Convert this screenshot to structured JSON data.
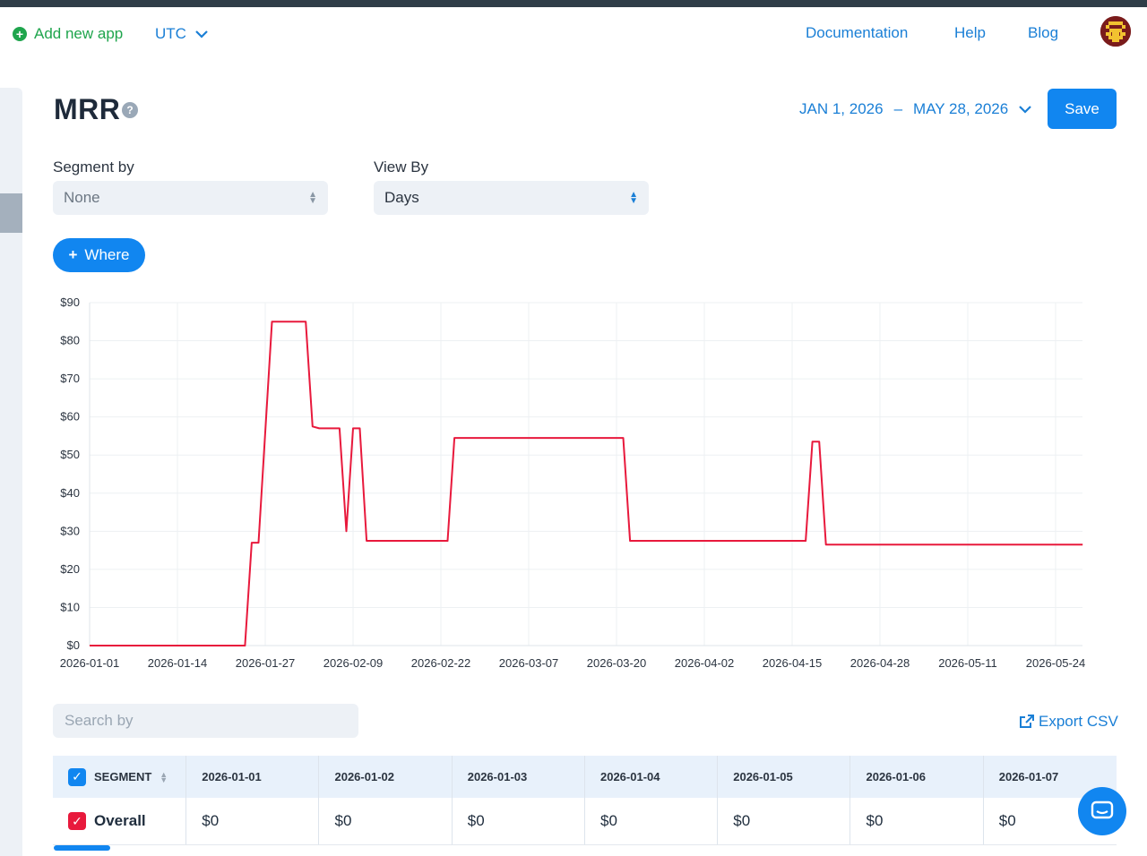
{
  "header": {
    "add_app_label": "Add new app",
    "timezone": "UTC",
    "nav": [
      {
        "label": "Documentation"
      },
      {
        "label": "Help"
      },
      {
        "label": "Blog"
      }
    ]
  },
  "page": {
    "title": "MRR",
    "help_symbol": "?",
    "date_start": "JAN 1, 2026",
    "date_separator": "–",
    "date_end": "MAY 28, 2026",
    "save_label": "Save",
    "segment_label": "Segment by",
    "segment_value": "None",
    "view_label": "View By",
    "view_value": "Days",
    "where_label": "Where",
    "search_placeholder": "Search by",
    "export_label": "Export CSV"
  },
  "chart_data": {
    "type": "line",
    "ylim": [
      0,
      90
    ],
    "yticks": [
      "$0",
      "$10",
      "$20",
      "$30",
      "$40",
      "$50",
      "$60",
      "$70",
      "$80",
      "$90"
    ],
    "xticks": [
      "2026-01-01",
      "2026-01-14",
      "2026-01-27",
      "2026-02-09",
      "2026-02-22",
      "2026-03-07",
      "2026-03-20",
      "2026-04-02",
      "2026-04-15",
      "2026-04-28",
      "2026-05-11",
      "2026-05-24"
    ],
    "color": "#e8193c",
    "series": [
      {
        "points": [
          [
            "2026-01-01",
            0
          ],
          [
            "2026-01-24",
            0
          ],
          [
            "2026-01-25",
            27
          ],
          [
            "2026-01-26",
            27
          ],
          [
            "2026-01-28",
            85
          ],
          [
            "2026-02-02",
            85
          ],
          [
            "2026-02-03",
            57.5
          ],
          [
            "2026-02-04",
            57
          ],
          [
            "2026-02-07",
            57
          ],
          [
            "2026-02-08",
            30
          ],
          [
            "2026-02-09",
            57
          ],
          [
            "2026-02-10",
            57
          ],
          [
            "2026-02-11",
            27.5
          ],
          [
            "2026-02-23",
            27.5
          ],
          [
            "2026-02-24",
            54.5
          ],
          [
            "2026-03-21",
            54.5
          ],
          [
            "2026-03-22",
            27.5
          ],
          [
            "2026-04-17",
            27.5
          ],
          [
            "2026-04-18",
            53.5
          ],
          [
            "2026-04-19",
            53.5
          ],
          [
            "2026-04-20",
            26.5
          ],
          [
            "2026-05-28",
            26.5
          ]
        ]
      }
    ]
  },
  "table": {
    "segment_header": "SEGMENT",
    "date_headers": [
      "2026-01-01",
      "2026-01-02",
      "2026-01-03",
      "2026-01-04",
      "2026-01-05",
      "2026-01-06",
      "2026-01-07"
    ],
    "rows": [
      {
        "label": "Overall",
        "values": [
          "$0",
          "$0",
          "$0",
          "$0",
          "$0",
          "$0",
          "$0"
        ]
      }
    ]
  },
  "colors": {
    "accent": "#1186f0",
    "link": "#1a7fd6",
    "add_green": "#1fa54d",
    "line_red": "#e8193c",
    "overall_checkbox": "#e8193c"
  }
}
